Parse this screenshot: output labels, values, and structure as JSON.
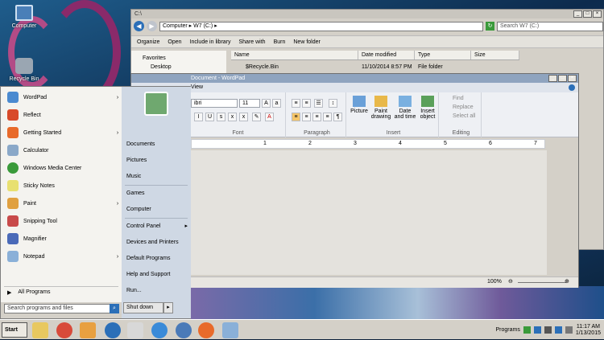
{
  "desktop": {
    "icons": [
      {
        "label": "Computer"
      },
      {
        "label": "Recycle Bin"
      }
    ]
  },
  "explorer": {
    "title": "C:\\",
    "breadcrumb": [
      "Computer",
      "W7 (C:)"
    ],
    "search_placeholder": "Search W7 (C:)",
    "commands": [
      "Organize",
      "Open",
      "Include in library",
      "Share with",
      "Burn",
      "New folder"
    ],
    "columns": [
      "Name",
      "Date modified",
      "Type",
      "Size"
    ],
    "nav": [
      "Favorites",
      "Desktop"
    ],
    "rows": [
      {
        "name": "$Recycle.Bin",
        "date": "11/10/2014 8:57 PM",
        "type": "File folder",
        "size": ""
      }
    ]
  },
  "wordpad": {
    "title": "Document - WordPad",
    "tab": "View",
    "font_name": "ibri",
    "font_size": "11",
    "groups": [
      "Font",
      "Paragraph",
      "Insert",
      "Editing"
    ],
    "insert_buttons": [
      "Picture",
      "Paint drawing",
      "Date and time",
      "Insert object"
    ],
    "editing_buttons": [
      "Find",
      "Replace",
      "Select all"
    ],
    "ruler_marks": [
      "1",
      "2",
      "3",
      "4",
      "5",
      "6",
      "7"
    ],
    "zoom": "100%"
  },
  "start_menu": {
    "left_items": [
      {
        "label": "WordPad",
        "arrow": "›"
      },
      {
        "label": "Reflect",
        "arrow": ""
      },
      {
        "label": "Getting Started",
        "arrow": "›"
      },
      {
        "label": "Calculator",
        "arrow": ""
      },
      {
        "label": "Windows Media Center",
        "arrow": ""
      },
      {
        "label": "Sticky Notes",
        "arrow": ""
      },
      {
        "label": "Paint",
        "arrow": "›"
      },
      {
        "label": "Snipping Tool",
        "arrow": ""
      },
      {
        "label": "Magnifier",
        "arrow": ""
      },
      {
        "label": "Notepad",
        "arrow": "›"
      }
    ],
    "all_programs": "All Programs",
    "search_placeholder": "Search programs and files",
    "right_items": [
      "Documents",
      "Pictures",
      "Music",
      "Games",
      "Computer",
      "Control Panel",
      "Devices and Printers",
      "Default Programs",
      "Help and Support",
      "Run..."
    ],
    "shutdown": "Shut down"
  },
  "taskbar": {
    "start": "Start",
    "programs": "Programs",
    "time": "11:17 AM",
    "date": "1/13/2015"
  },
  "colors": {
    "accent": "#2b6fb8",
    "reef": "#7a6aa8"
  }
}
